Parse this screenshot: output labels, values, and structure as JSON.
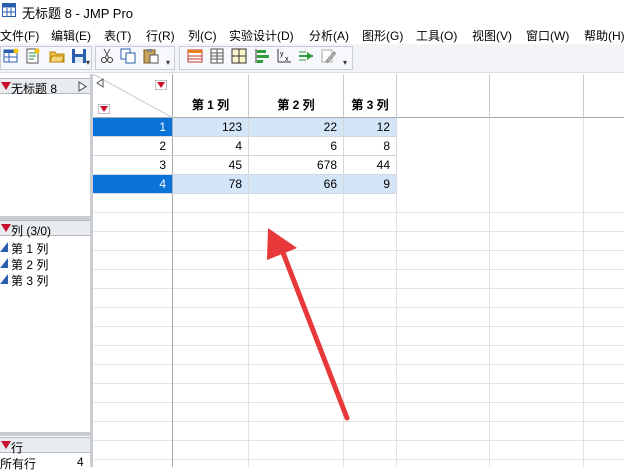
{
  "window": {
    "title": "无标题 8 - JMP Pro"
  },
  "menu": [
    {
      "label": "文件(F)"
    },
    {
      "label": "编辑(E)"
    },
    {
      "label": "表(T)"
    },
    {
      "label": "行(R)"
    },
    {
      "label": "列(C)"
    },
    {
      "label": "实验设计(D)"
    },
    {
      "label": "分析(A)"
    },
    {
      "label": "图形(G)"
    },
    {
      "label": "工具(O)"
    },
    {
      "label": "视图(V)"
    },
    {
      "label": "窗口(W)"
    },
    {
      "label": "帮助(H)"
    }
  ],
  "toolbar": {
    "buttons": [
      "new-table-icon",
      "new-script-icon",
      "open-folder-icon",
      "save-icon",
      "cut-icon",
      "copy-icon",
      "paste-icon",
      "data-table-icon",
      "spreadsheet-icon",
      "grid-icon",
      "bar-chart-icon",
      "fit-xy-icon",
      "scatter-icon",
      "script-pencil-icon"
    ]
  },
  "left": {
    "table_panel": {
      "label": "无标题 8"
    },
    "columns_panel": {
      "label": "列 (3/0)",
      "items": [
        {
          "label": "第 1 列"
        },
        {
          "label": "第 2 列"
        },
        {
          "label": "第 3 列"
        }
      ]
    },
    "rows_panel": {
      "label": "行",
      "all_rows_label": "所有行",
      "all_rows_value": "4"
    }
  },
  "table": {
    "columns": [
      {
        "label": "第 1 列"
      },
      {
        "label": "第 2 列"
      },
      {
        "label": "第 3 列"
      }
    ],
    "rows": [
      {
        "num": "1",
        "selected": true,
        "cells": [
          "123",
          "22",
          "12"
        ]
      },
      {
        "num": "2",
        "selected": false,
        "cells": [
          "4",
          "6",
          "8"
        ]
      },
      {
        "num": "3",
        "selected": false,
        "cells": [
          "45",
          "678",
          "44"
        ]
      },
      {
        "num": "4",
        "selected": true,
        "cells": [
          "78",
          "66",
          "9"
        ]
      }
    ]
  },
  "colors": {
    "selection": "#0a73d7",
    "selected_cell": "#d3e5f6",
    "annotation_arrow": "#e8393a",
    "triangle": "#c8102e"
  }
}
